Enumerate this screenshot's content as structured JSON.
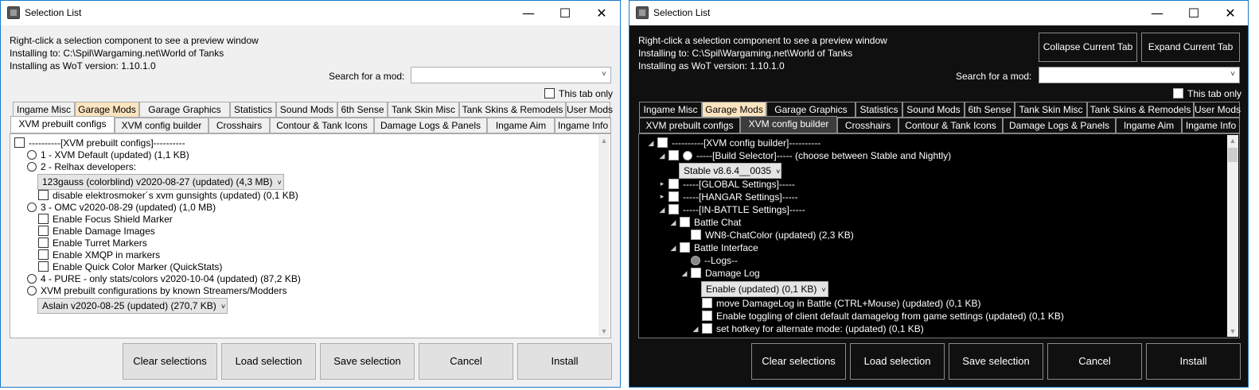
{
  "window_title": "Selection List",
  "controls": {
    "minimize": "—",
    "maximize": "☐",
    "close": "✕"
  },
  "info": {
    "line1": "Right-click a selection component to see a preview window",
    "line2": "Installing to: C:\\Spil\\Wargaming.net\\World of Tanks",
    "line3": "Installing as WoT version: 1.10.1.0"
  },
  "search_label": "Search for a mod:",
  "search_value": "",
  "tab_only": "This tab only",
  "top_buttons": {
    "collapse": "Collapse Current Tab",
    "expand": "Expand Current Tab"
  },
  "tabs_row1": [
    "Ingame Misc",
    "Garage Mods",
    "Garage Graphics",
    "Statistics",
    "Sound Mods",
    "6th Sense",
    "Tank Skin Misc",
    "Tank Skins & Remodels",
    "User Mods"
  ],
  "tabs_row2": [
    "XVM prebuilt configs",
    "XVM config builder",
    "Crosshairs",
    "Contour & Tank Icons",
    "Damage Logs & Panels",
    "Ingame Aim",
    "Ingame Info"
  ],
  "left_tree": [
    "----------[XVM prebuilt configs]----------",
    "1 - XVM Default (updated) (1,1 KB)",
    "2 - Relhax developers:",
    "123gauss (colorblind) v2020-08-27 (updated) (4,3 MB)",
    "disable elektrosmoker´s xvm gunsights (updated) (0,1 KB)",
    "3 - OMC v2020-08-29 (updated) (1,0 MB)",
    "Enable Focus Shield Marker",
    "Enable Damage Images",
    "Enable Turret Markers",
    "Enable XMQP in markers",
    "Enable Quick Color Marker (QuickStats)",
    "4 - PURE - only stats/colors v2020-10-04 (updated) (87,2 KB)",
    "XVM prebuilt configurations by known Streamers/Modders",
    "Aslain v2020-08-25 (updated) (270,7 KB)"
  ],
  "right_tree": [
    "----------[XVM config builder]----------",
    "-----[Build Selector]----- (choose between Stable and Nightly)",
    "Stable v8.6.4__0035",
    "-----[GLOBAL Settings]-----",
    "-----[HANGAR Settings]-----",
    "-----[IN-BATTLE Settings]-----",
    "Battle Chat",
    "WN8-ChatColor (updated) (2,3 KB)",
    "Battle Interface",
    "--Logs--",
    "Damage Log",
    "Enable (updated) (0,1 KB)",
    "move DamageLog in Battle (CTRL+Mouse) (updated) (0,1 KB)",
    "Enable toggling of client default damagelog from game settings (updated) (0,1 KB)",
    "set hotkey for alternate mode: (updated) (0,1 KB)"
  ],
  "bottom_buttons": [
    "Clear selections",
    "Load selection",
    "Save selection",
    "Cancel",
    "Install"
  ],
  "icons": {
    "expand": "▸",
    "collapse": "◢",
    "chevron": "˅"
  }
}
